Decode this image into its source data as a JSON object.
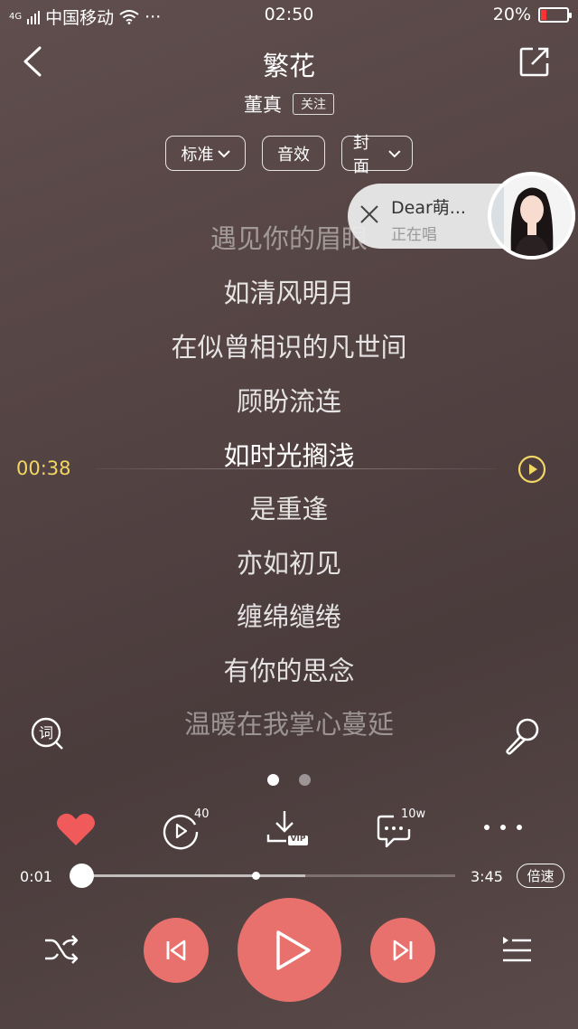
{
  "status_bar": {
    "network": "4G",
    "carrier": "中国移动",
    "more": "···",
    "time": "02:50",
    "battery_percent": "20%",
    "battery_level": 0.2
  },
  "header": {
    "title": "繁花",
    "artist": "董真",
    "follow_label": "关注"
  },
  "tabs": [
    {
      "label": "标准",
      "has_dropdown": true
    },
    {
      "label": "音效",
      "has_dropdown": false
    },
    {
      "label": "封面",
      "has_dropdown": true
    }
  ],
  "now_singing": {
    "name": "Dear萌...",
    "status": "正在唱"
  },
  "lyrics": [
    "遇见你的眉眼",
    "如清风明月",
    "在似曾相识的凡世间",
    "顾盼流连",
    "如时光搁浅",
    "是重逢",
    "亦如初见",
    "缠绵缱绻",
    "有你的思念",
    "温暖在我掌心蔓延"
  ],
  "current_lyric_index": 4,
  "seek_time": "00:38",
  "pager": {
    "count": 2,
    "active": 0
  },
  "actions": {
    "video_count": "40",
    "comment_count": "10w",
    "download_badge": "VIP"
  },
  "progress": {
    "current": "0:01",
    "total": "3:45",
    "played_fraction": 0.005,
    "buffered_fraction": 0.61,
    "speed_label": "倍速"
  },
  "colors": {
    "accent": "#e9716d",
    "like": "#f05a5a",
    "seek_time": "#f1d763"
  }
}
